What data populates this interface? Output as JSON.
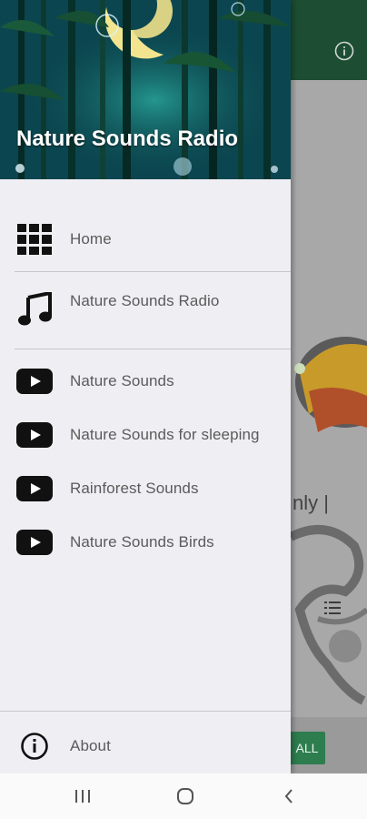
{
  "drawer": {
    "title": "Nature Sounds Radio",
    "items": [
      {
        "label": "Home",
        "icon": "grid-icon"
      },
      {
        "label": "Nature Sounds Radio",
        "icon": "music-note-icon"
      },
      {
        "label": "Nature Sounds",
        "icon": "youtube-icon"
      },
      {
        "label": "Nature Sounds for sleeping",
        "icon": "youtube-icon"
      },
      {
        "label": "Rainforest Sounds",
        "icon": "youtube-icon"
      },
      {
        "label": "Nature Sounds Birds",
        "icon": "youtube-icon"
      }
    ],
    "footer": {
      "label": "About",
      "icon": "info-icon"
    }
  },
  "background": {
    "partial_text": "nly |",
    "button_label": "ALL"
  },
  "colors": {
    "appbar": "#1d4d33",
    "drawer_bg": "#efeff3",
    "accent_button": "#2e7d4f"
  }
}
